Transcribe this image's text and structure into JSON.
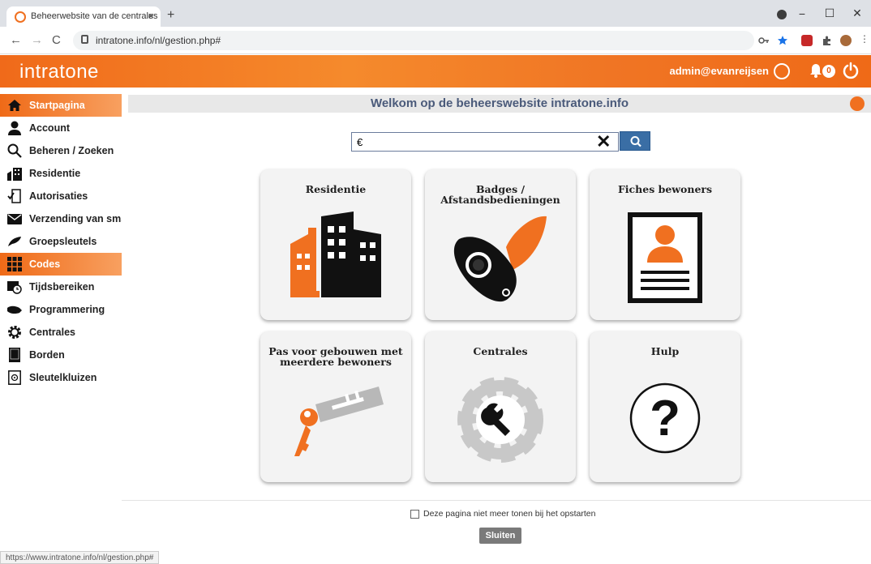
{
  "browser": {
    "tab_title": "Beheerwebsite van de centrales",
    "tab_close": "×",
    "new_tab": "+",
    "url": "intratone.info/nl/gestion.php#",
    "window_controls": [
      "−",
      "☐",
      "✕"
    ],
    "nav": {
      "back": "←",
      "forward": "→",
      "reload": "C"
    }
  },
  "header": {
    "logo": "intratone",
    "user_email": "admin@evanreijsen",
    "notification_count": "0"
  },
  "sidebar": {
    "items": [
      {
        "label": "Startpagina",
        "icon": "home-icon"
      },
      {
        "label": "Account",
        "icon": "person-icon"
      },
      {
        "label": "Beheren / Zoeken",
        "icon": "search-icon"
      },
      {
        "label": "Residentie",
        "icon": "buildings-icon"
      },
      {
        "label": "Autorisaties",
        "icon": "door-icon"
      },
      {
        "label": "Verzending van sms",
        "icon": "envelope-icon"
      },
      {
        "label": "Groepsleutels",
        "icon": "key-fob-icon"
      },
      {
        "label": "Codes",
        "icon": "keypad-icon"
      },
      {
        "label": "Tijdsbereiken",
        "icon": "calendar-clock-icon"
      },
      {
        "label": "Programmering",
        "icon": "programmer-icon"
      },
      {
        "label": "Centrales",
        "icon": "gear-icon"
      },
      {
        "label": "Borden",
        "icon": "panel-icon"
      },
      {
        "label": "Sleutelkluizen",
        "icon": "safe-icon"
      }
    ],
    "active": [
      "Startpagina",
      "Codes"
    ]
  },
  "main": {
    "welcome": "Welkom op de beheerswebsite intratone.info",
    "search": {
      "value": "€",
      "clear": "✕"
    },
    "tiles": [
      {
        "label": "Residentie",
        "icon": "residence-icon"
      },
      {
        "label": "Badges / Afstandsbedieningen",
        "icon": "badge-icon"
      },
      {
        "label": "Fiches bewoners",
        "icon": "resident-card-icon"
      },
      {
        "label": "Pas voor gebouwen met meerdere bewoners",
        "icon": "multi-resident-pass-icon"
      },
      {
        "label": "Centrales",
        "icon": "central-gear-icon"
      },
      {
        "label": "Hulp",
        "icon": "help-icon"
      }
    ]
  },
  "footer": {
    "dont_show_label": "Deze pagina niet meer tonen bij het opstarten",
    "close_label": "Sluiten",
    "status_url": "https://www.intratone.info/nl/gestion.php#"
  },
  "colors": {
    "accent": "#f07020",
    "nav_blue": "#3a6ea5",
    "title_text": "#4a5a7a"
  }
}
